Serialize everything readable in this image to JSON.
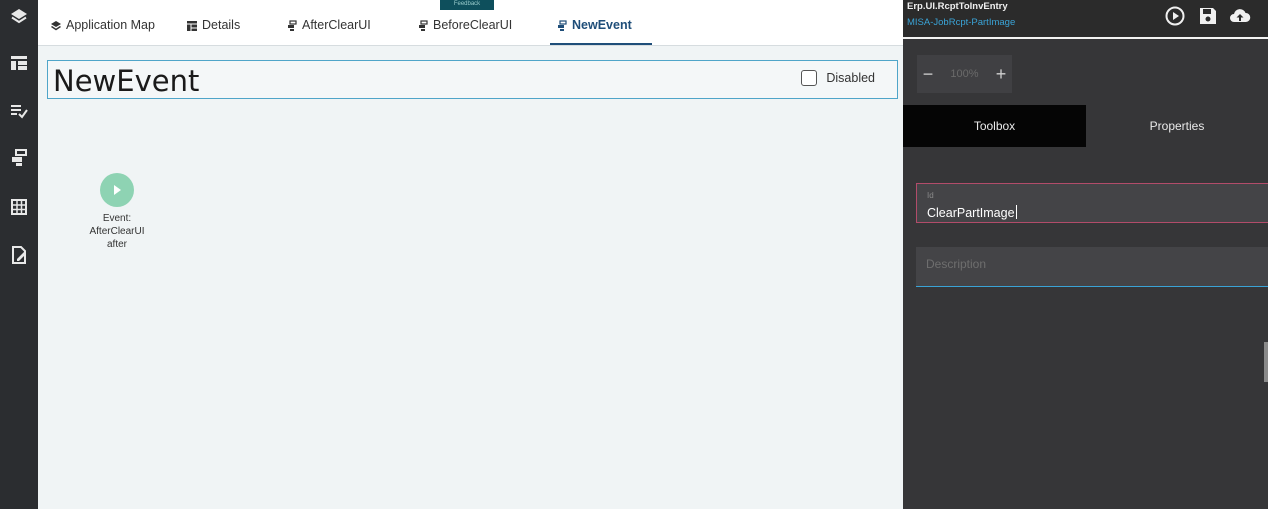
{
  "tabs": [
    {
      "label": "Application Map",
      "icon": "layers-icon"
    },
    {
      "label": "Details",
      "icon": "table-icon"
    },
    {
      "label": "AfterClearUI",
      "icon": "flow-icon"
    },
    {
      "label": "BeforeClearUI",
      "icon": "flow-icon"
    },
    {
      "label": "NewEvent",
      "icon": "flow-icon",
      "active": true
    }
  ],
  "feedback_label": "Feedback",
  "editor": {
    "title": "NewEvent",
    "disabled_label": "Disabled",
    "disabled_checked": false
  },
  "event_node": {
    "line1": "Event:",
    "line2": "AfterClearUI",
    "line3": "after"
  },
  "right_panel": {
    "app_name": "Erp.UI.RcptToInvEntry",
    "layer_name": "MISA-JobRcpt-PartImage",
    "zoom": {
      "minus": "−",
      "value": "100%",
      "plus": "+"
    },
    "tabs": {
      "toolbox": "Toolbox",
      "properties": "Properties"
    },
    "id_field": {
      "label": "Id",
      "value": "ClearPartImage"
    },
    "description_field": {
      "placeholder": "Description",
      "value": ""
    }
  },
  "colors": {
    "accent": "#1f4e79",
    "event_green": "#8ed3b3",
    "field_focus": "#3aa3d6",
    "field_error": "#b24c6a"
  }
}
